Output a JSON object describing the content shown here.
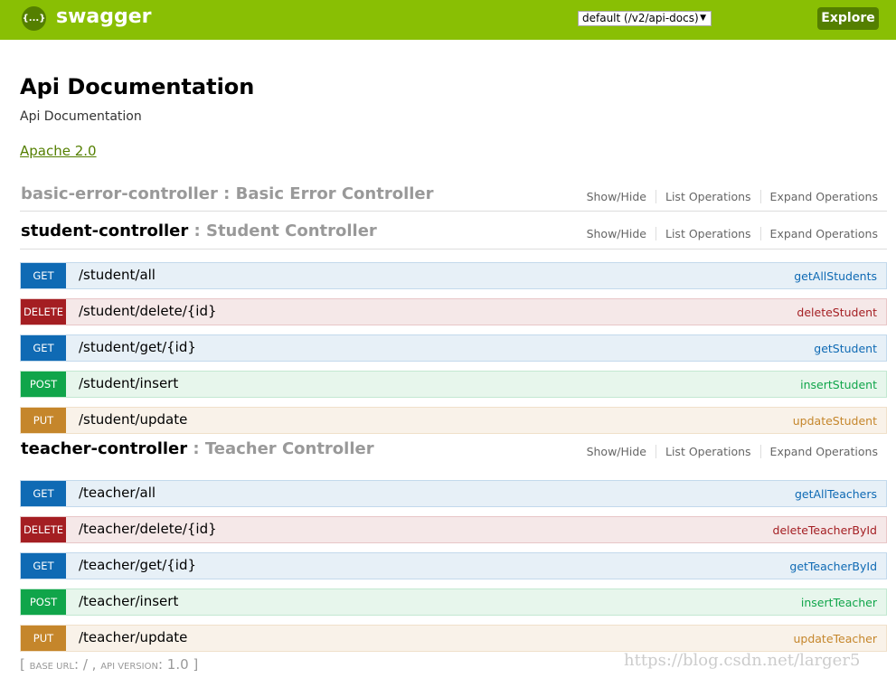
{
  "header": {
    "brand": "swagger",
    "logo_text": "{...}",
    "spec_select": "default (/v2/api-docs)",
    "explore_label": "Explore",
    "color": "#89bf04"
  },
  "info": {
    "title": "Api Documentation",
    "description": "Api Documentation",
    "license": "Apache 2.0"
  },
  "ops_labels": {
    "show_hide": "Show/Hide",
    "list": "List Operations",
    "expand": "Expand Operations"
  },
  "controllers": [
    {
      "name": "basic-error-controller",
      "sep": " : ",
      "desc": "Basic Error Controller",
      "endpoints": []
    },
    {
      "name": "student-controller",
      "sep": " : ",
      "desc": "Student Controller",
      "endpoints": [
        {
          "method": "GET",
          "path": "/student/all",
          "nick": "getAllStudents"
        },
        {
          "method": "DELETE",
          "path": "/student/delete/{id}",
          "nick": "deleteStudent"
        },
        {
          "method": "GET",
          "path": "/student/get/{id}",
          "nick": "getStudent"
        },
        {
          "method": "POST",
          "path": "/student/insert",
          "nick": "insertStudent"
        },
        {
          "method": "PUT",
          "path": "/student/update",
          "nick": "updateStudent"
        }
      ]
    },
    {
      "name": "teacher-controller",
      "sep": " : ",
      "desc": "Teacher Controller",
      "endpoints": [
        {
          "method": "GET",
          "path": "/teacher/all",
          "nick": "getAllTeachers"
        },
        {
          "method": "DELETE",
          "path": "/teacher/delete/{id}",
          "nick": "deleteTeacherById"
        },
        {
          "method": "GET",
          "path": "/teacher/get/{id}",
          "nick": "getTeacherById"
        },
        {
          "method": "POST",
          "path": "/teacher/insert",
          "nick": "insertTeacher"
        },
        {
          "method": "PUT",
          "path": "/teacher/update",
          "nick": "updateTeacher"
        }
      ]
    }
  ],
  "footer": {
    "open": "[ ",
    "base_label": "BASE URL",
    "base": ": / , ",
    "ver_label": "API VERSION",
    "ver": ": 1.0 ]"
  },
  "watermark": "https://blog.csdn.net/larger5"
}
